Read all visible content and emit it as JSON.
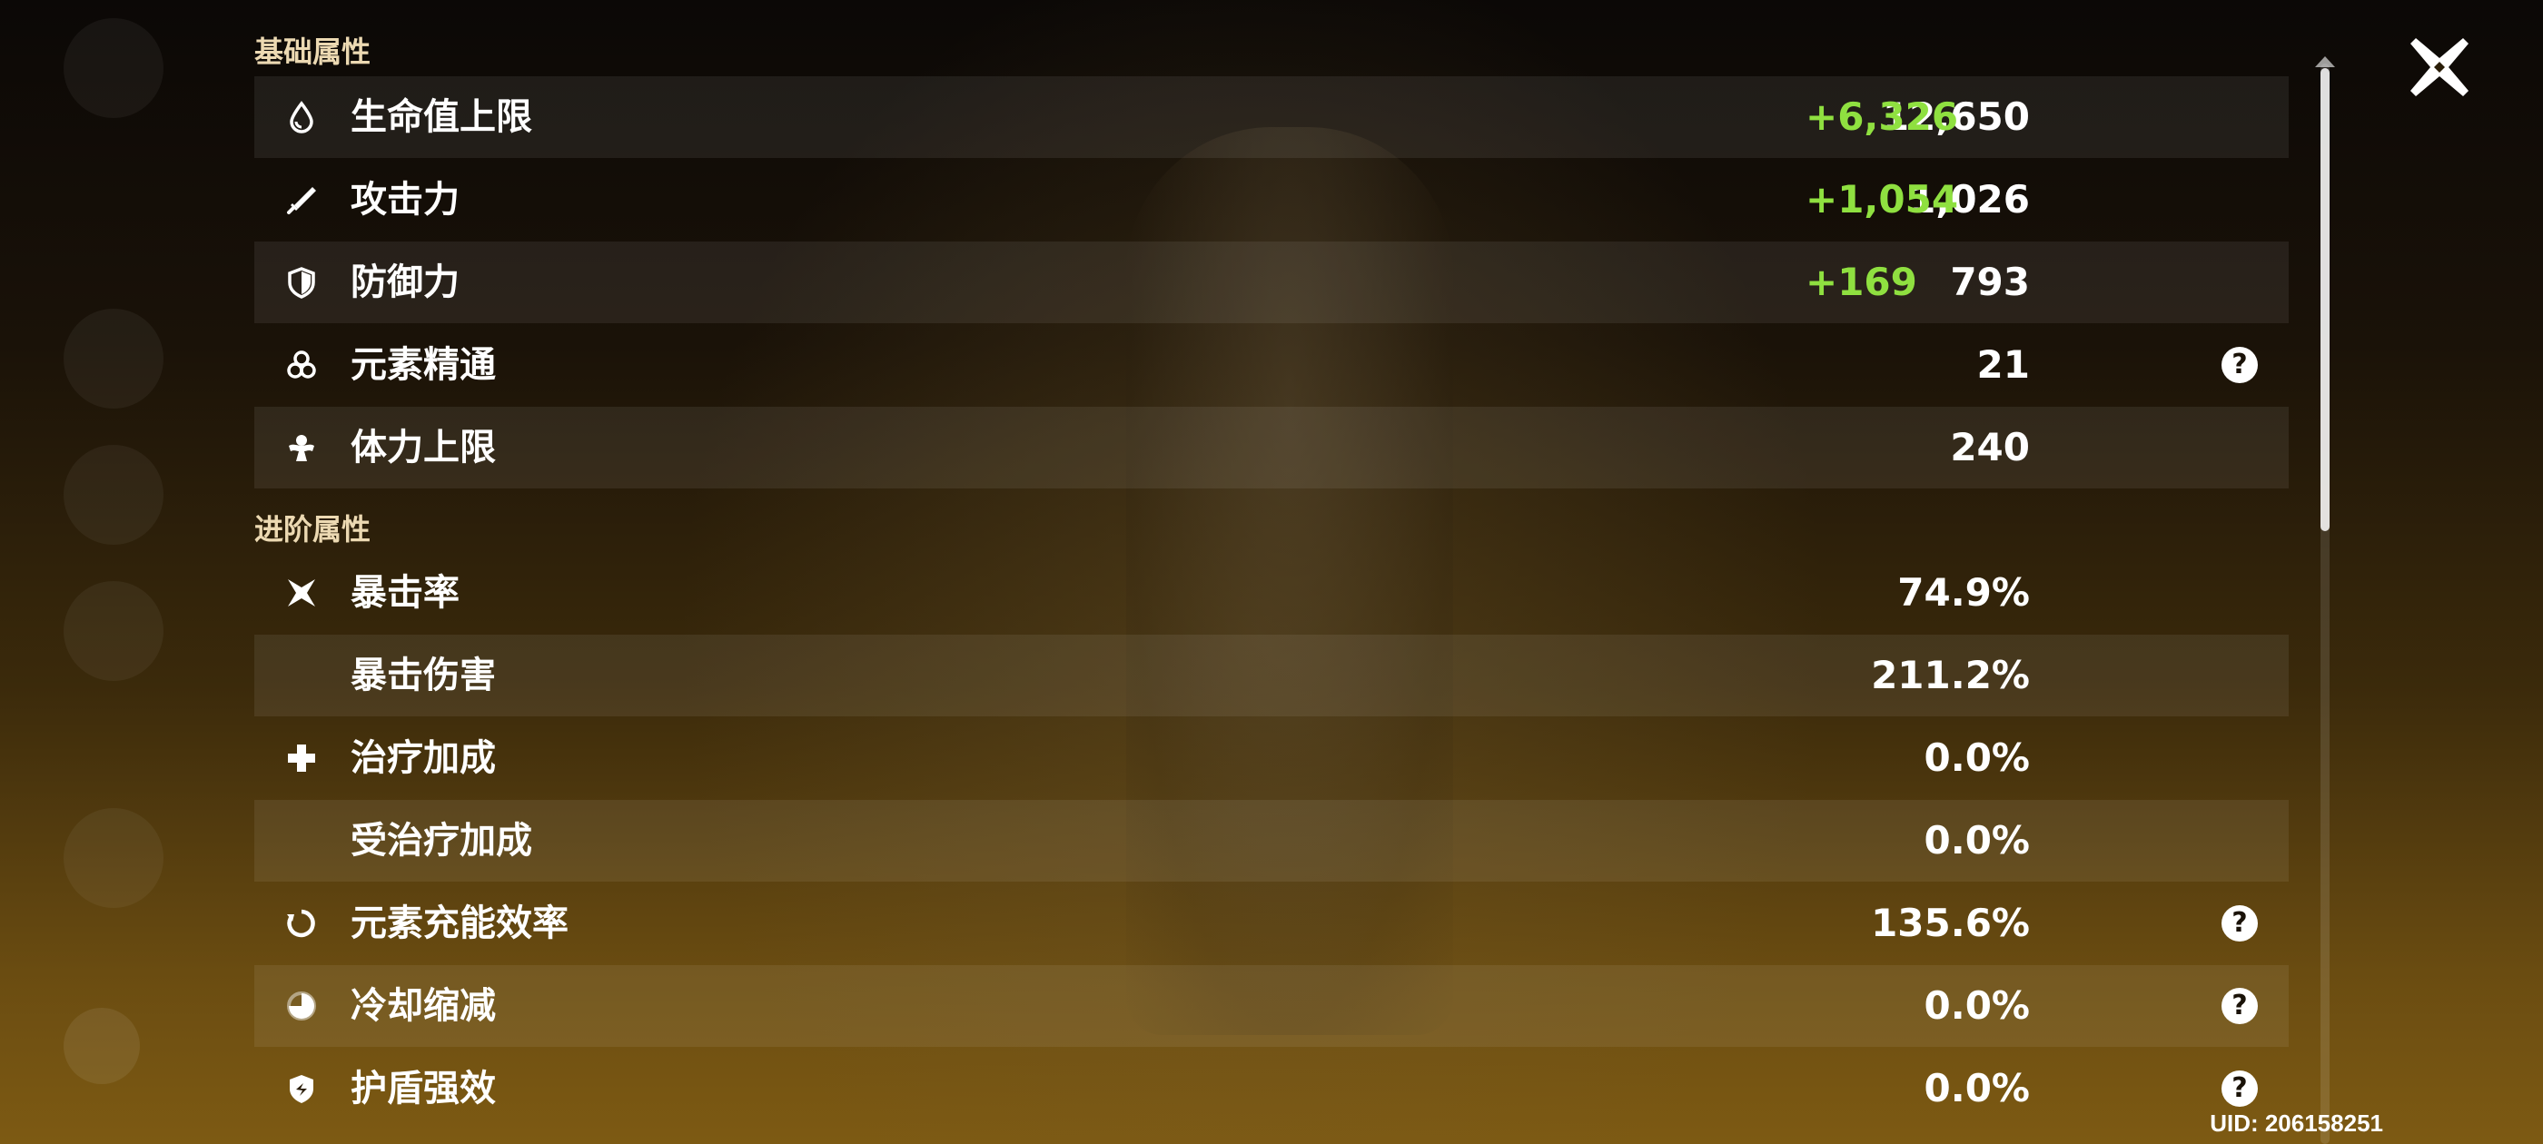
{
  "sections": {
    "basic": "基础属性",
    "advanced": "进阶属性"
  },
  "basic_stats": [
    {
      "label": "生命值上限",
      "value": "12,650",
      "bonus": "+6,326",
      "icon": "hp-drop-icon"
    },
    {
      "label": "攻击力",
      "value": "1,026",
      "bonus": "+1,054",
      "icon": "attack-sword-icon"
    },
    {
      "label": "防御力",
      "value": "793",
      "bonus": "+169",
      "icon": "defense-shield-icon"
    },
    {
      "label": "元素精通",
      "value": "21",
      "has_help": true,
      "icon": "elemental-mastery-icon"
    },
    {
      "label": "体力上限",
      "value": "240",
      "icon": "stamina-icon"
    }
  ],
  "advanced_stats": [
    {
      "label": "暴击率",
      "value": "74.9%",
      "icon": "crit-rate-icon"
    },
    {
      "label": "暴击伤害",
      "value": "211.2%"
    },
    {
      "label": "治疗加成",
      "value": "0.0%",
      "icon": "healing-cross-icon"
    },
    {
      "label": "受治疗加成",
      "value": "0.0%"
    },
    {
      "label": "元素充能效率",
      "value": "135.6%",
      "has_help": true,
      "icon": "energy-recharge-icon"
    },
    {
      "label": "冷却缩减",
      "value": "0.0%",
      "has_help": true,
      "icon": "cooldown-icon"
    },
    {
      "label": "护盾强效",
      "value": "0.0%",
      "has_help": true,
      "icon": "shield-strength-icon"
    }
  ],
  "help_symbol": "?",
  "uid": "UID: 206158251",
  "colors": {
    "bonus": "#8fe040",
    "section_header": "#ecd9b2",
    "row_shade": "rgba(255,255,255,0.075)"
  }
}
